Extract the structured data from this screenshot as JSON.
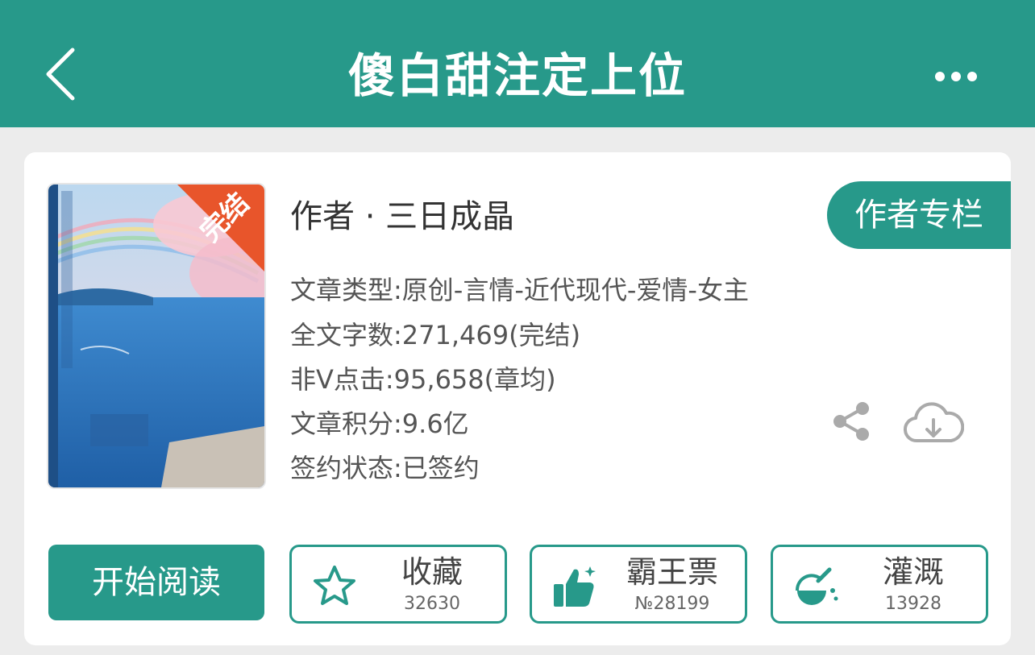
{
  "header": {
    "title": "傻白甜注定上位",
    "back_icon": "chevron-left-icon",
    "more_icon": "ellipsis-icon"
  },
  "book": {
    "cover_badge": "完结",
    "author_line": "作者 · 三日成晶",
    "author_column_label": "作者专栏",
    "info": [
      "文章类型:原创-言情-近代现代-爱情-女主",
      "全文字数:271,469(完结)",
      "非V点击:95,658(章均)",
      "文章积分:9.6亿",
      "签约状态:已签约"
    ]
  },
  "actions": {
    "read_label": "开始阅读",
    "collect": {
      "label": "收藏",
      "count": "32630"
    },
    "ticket": {
      "label": "霸王票",
      "count": "№28199"
    },
    "water": {
      "label": "灌溉",
      "count": "13928"
    }
  },
  "colors": {
    "primary": "#27998a",
    "badge": "#e8552b"
  }
}
